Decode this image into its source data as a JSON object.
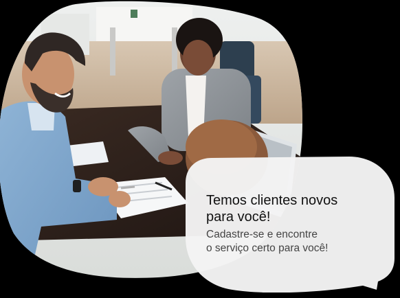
{
  "photo": {
    "subject": "business-meeting-photo"
  },
  "callout": {
    "headline_lines": [
      "Temos clientes novos",
      "para você!"
    ],
    "subtext_lines": [
      "Cadastre-se e encontre",
      "o serviço certo para você!"
    ]
  },
  "colors": {
    "background": "#000000",
    "bubble_fill": "#f4f4f4",
    "headline_text": "#111111",
    "subtext_text": "#444444"
  }
}
